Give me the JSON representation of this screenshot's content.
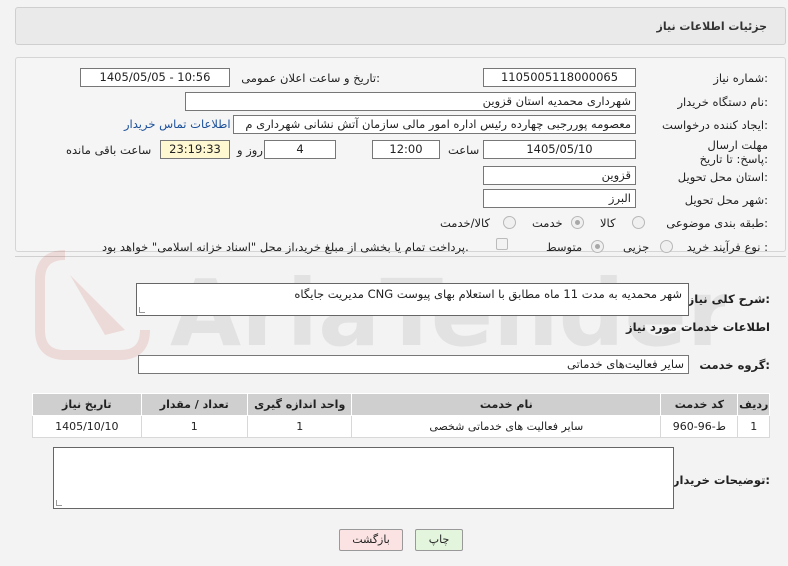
{
  "header": {
    "title": "جزئیات اطلاعات نیاز"
  },
  "form": {
    "need_number_label": "شماره نیاز:",
    "need_number": "1105005118000065",
    "announce_datetime_label": "تاریخ و ساعت اعلان عمومی:",
    "announce_datetime": "1405/05/05 - 10:56",
    "buyer_org_label": "نام دستگاه خریدار:",
    "buyer_org": "شهرداری محمدیه استان قزوین",
    "creator_label": "ایجاد کننده درخواست:",
    "creator": "معصومه پوررجبی چهارده رئیس اداره امور مالی سازمان آتش نشانی شهرداری م",
    "contact_link": "اطلاعات تماس خریدار",
    "deadline_label": "مهلت ارسال پاسخ: تا تاریخ:",
    "deadline_date": "1405/05/10",
    "time_label": "ساعت",
    "deadline_time": "12:00",
    "days_value": "4",
    "days_label": "روز و",
    "remaining_time": "23:19:33",
    "remaining_label": "ساعت باقی مانده",
    "province_label": "استان محل تحویل:",
    "province": "قزوین",
    "city_label": "شهر محل تحویل:",
    "city": "البرز",
    "category_label": "طبقه بندی موضوعی:",
    "category_options": [
      "کالا",
      "خدمت",
      "کالا/خدمت"
    ],
    "category_selected": "خدمت",
    "process_label": "نوع فرآیند خرید :",
    "process_options": [
      "جزیی",
      "متوسط"
    ],
    "process_selected": "متوسط",
    "payment_note": "پرداخت تمام یا بخشی از مبلغ خرید،از محل \"اسناد خزانه اسلامی\" خواهد بود."
  },
  "summary": {
    "label": "شرح کلی نیاز:",
    "text": "مدیریت جایگاه CNG شهر محمدیه به مدت 11 ماه مطابق با استعلام بهای پیوست"
  },
  "services": {
    "section_title": "اطلاعات خدمات مورد نیاز",
    "group_label": "گروه خدمت:",
    "group_value": "سایر فعالیت‌های خدماتی",
    "columns": [
      "ردیف",
      "کد خدمت",
      "نام خدمت",
      "واحد اندازه گیری",
      "تعداد / مقدار",
      "تاریخ نیاز"
    ],
    "rows": [
      {
        "row": "1",
        "code": "ط-96-960",
        "name": "سایر فعالیت های خدماتی شخصی",
        "unit": "1",
        "qty": "1",
        "date": "1405/10/10"
      }
    ]
  },
  "buyer_notes": {
    "label": "توضیحات خریدار:",
    "value": ""
  },
  "buttons": {
    "print": "چاپ",
    "back": "بازگشت"
  },
  "watermark_text": "AriaTender.net",
  "colors": {
    "link": "#1a4f9a",
    "print_bg": "#e3f5dc",
    "back_bg": "#fbe3e3",
    "table_header": "#cfcfcf"
  }
}
